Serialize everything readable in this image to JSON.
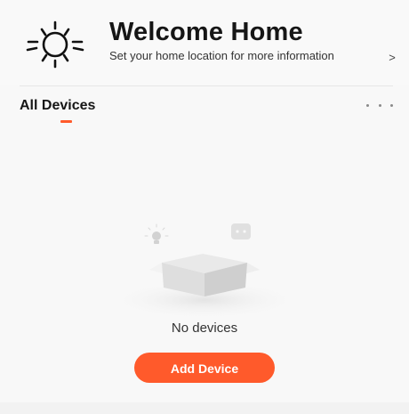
{
  "header": {
    "title": "Welcome Home",
    "subtitle": "Set your home location for more information",
    "chevron": ">",
    "icon": "sun-icon"
  },
  "devices": {
    "tab_label": "All Devices",
    "more_icon": "more-horizontal-icon",
    "empty_text": "No devices",
    "empty_icon": "empty-box-icon",
    "add_button_label": "Add Device"
  },
  "colors": {
    "accent": "#ff5a2b",
    "background": "#f8f8f8",
    "text": "#161616"
  }
}
